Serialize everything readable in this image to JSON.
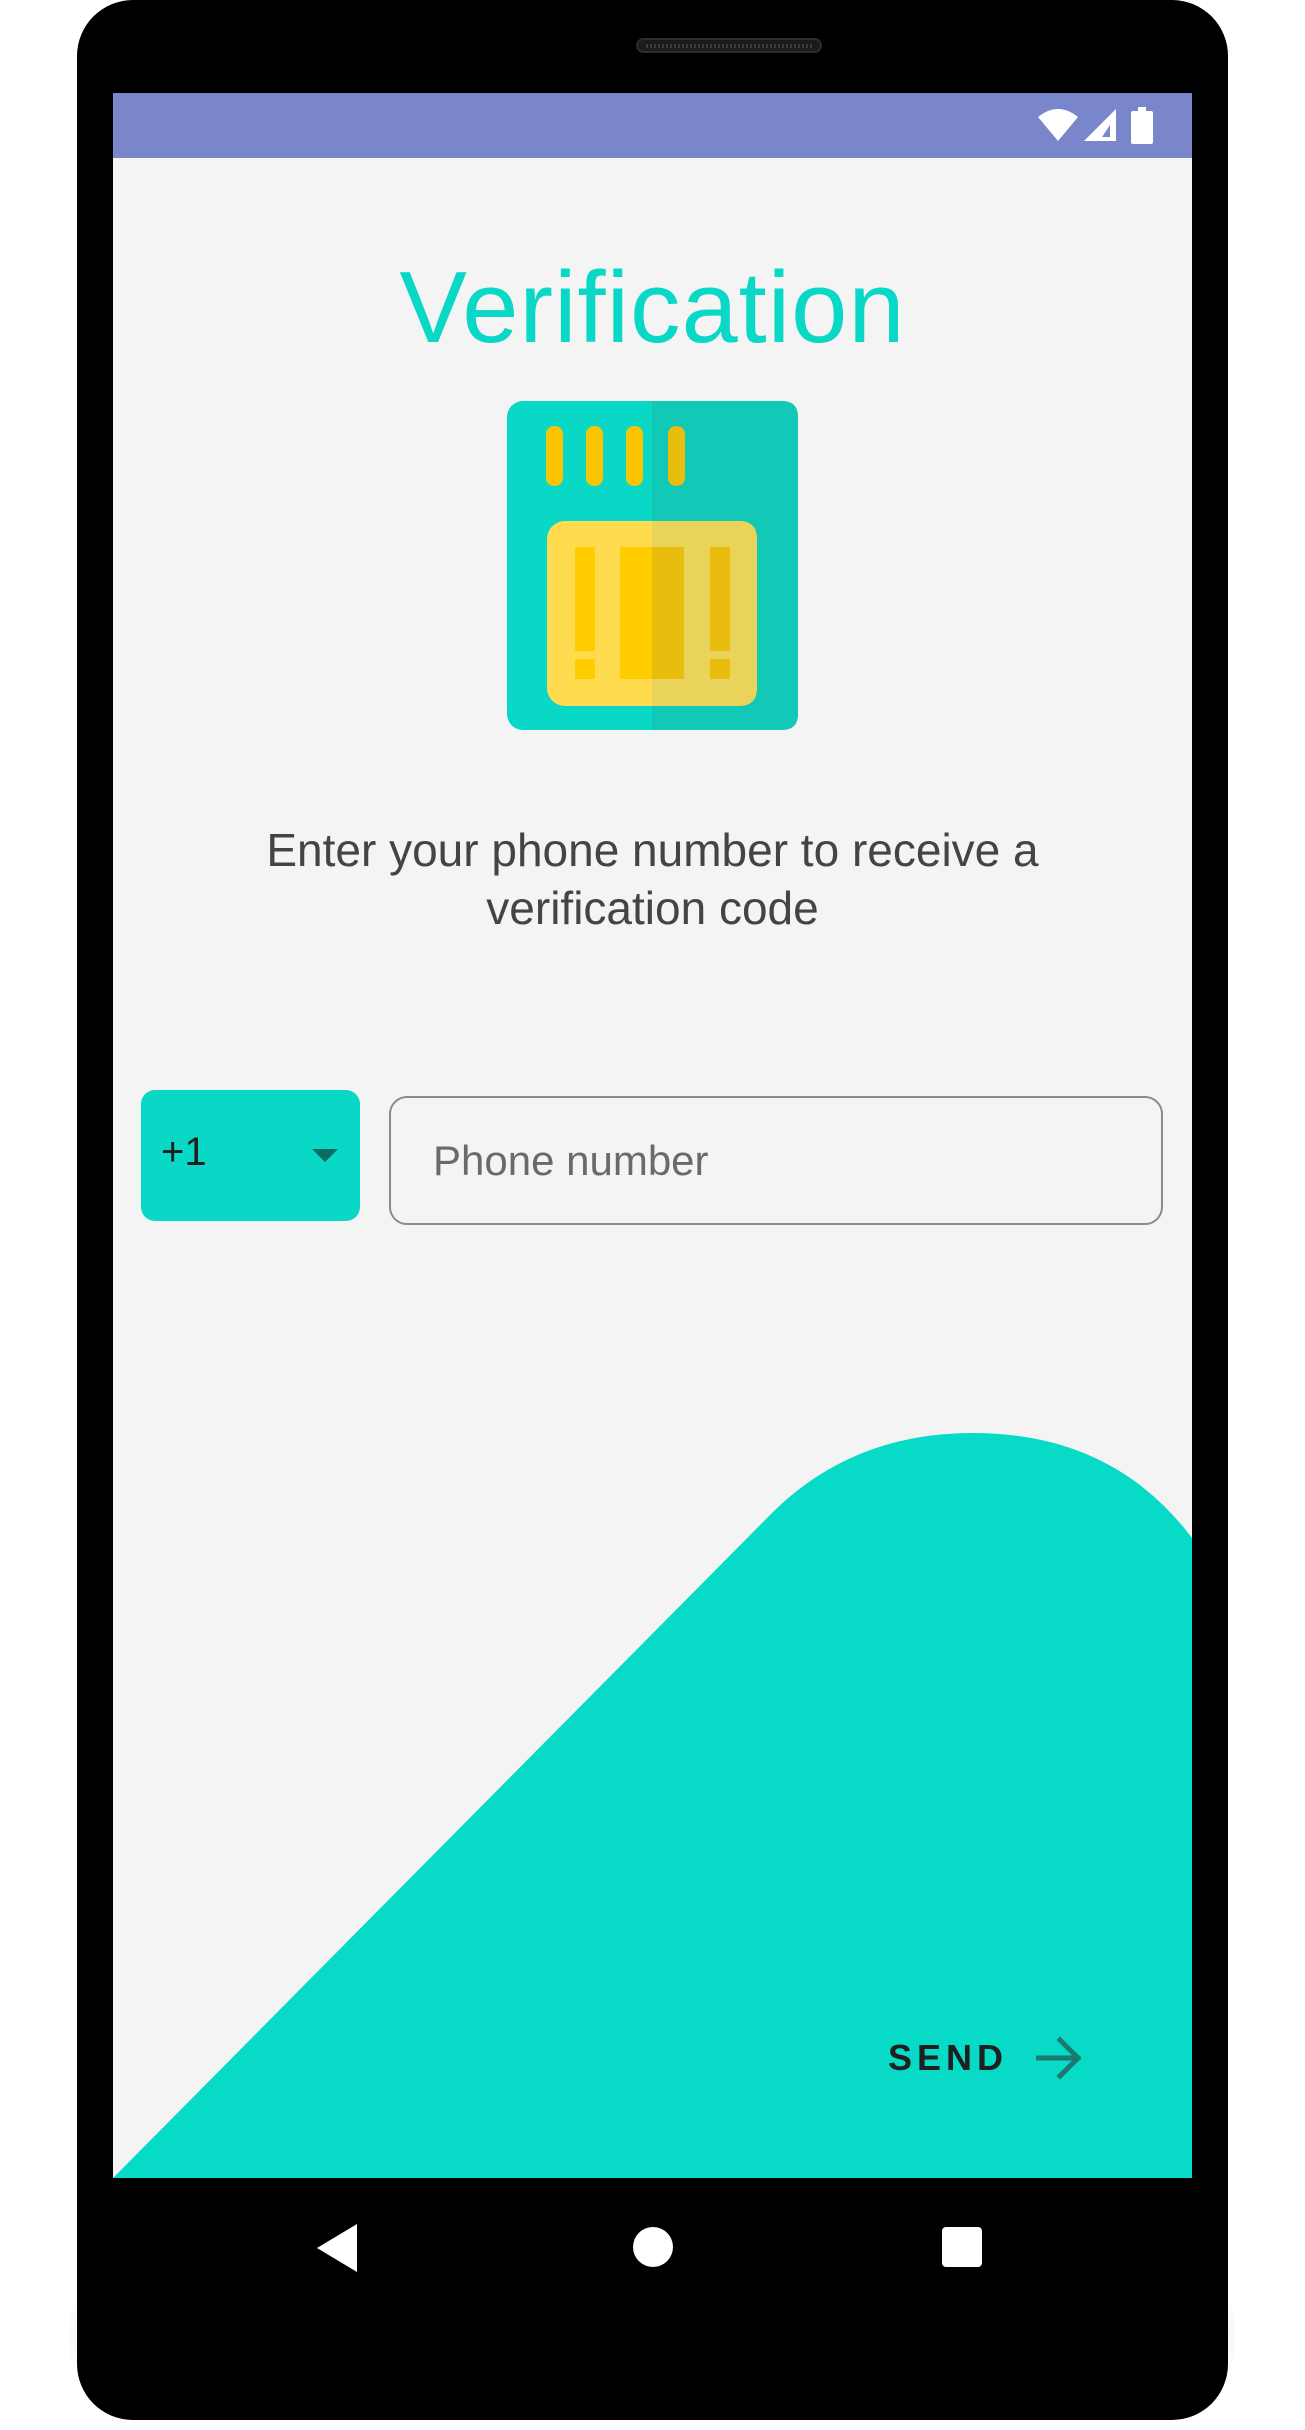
{
  "app": {
    "title": "Verification",
    "instructions": "Enter your phone number to receive a verification code"
  },
  "form": {
    "country_code": "+1",
    "phone_placeholder": "Phone number",
    "phone_value": ""
  },
  "actions": {
    "send_label": "SEND"
  },
  "status_bar": {
    "icons": [
      "wifi-icon",
      "signal-icon",
      "battery-icon"
    ]
  },
  "nav_bar": {
    "icons": [
      "back-icon",
      "home-icon",
      "recents-icon"
    ]
  },
  "colors": {
    "status_bar": "#7986cb",
    "accent": "#0ad8c6",
    "background": "#f4f4f4",
    "sim_chip": "#ffd54f"
  }
}
